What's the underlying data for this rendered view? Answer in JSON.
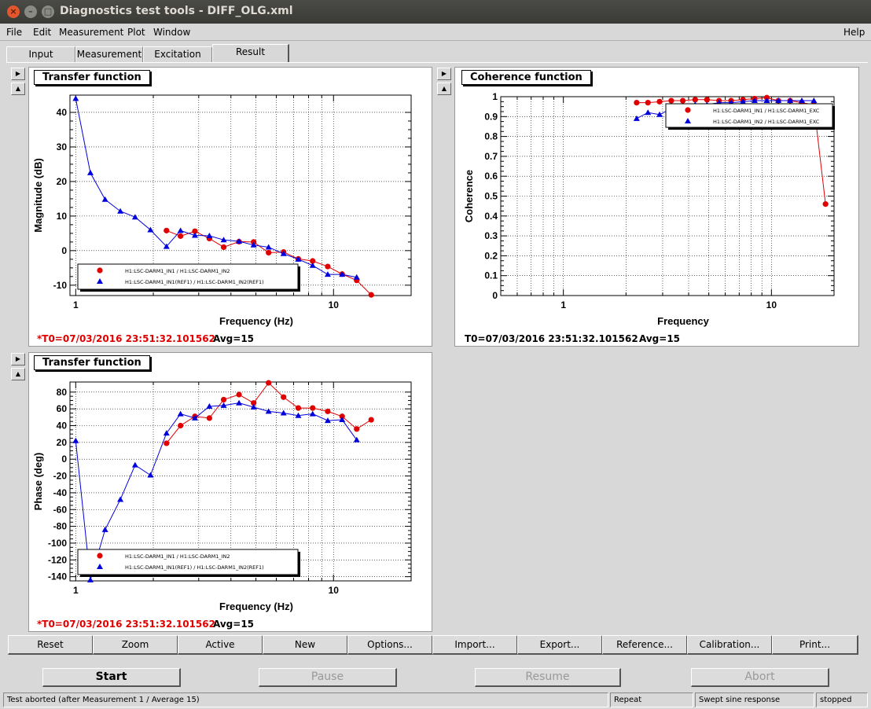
{
  "window": {
    "title": "Diagnostics test tools - DIFF_OLG.xml"
  },
  "menu": {
    "file": "File",
    "edit": "Edit",
    "measurement": "Measurement",
    "plot": "Plot",
    "window": "Window",
    "help": "Help"
  },
  "tabs": [
    {
      "label": "Input"
    },
    {
      "label": "Measurement"
    },
    {
      "label": "Excitation"
    },
    {
      "label": "Result",
      "active": true
    }
  ],
  "panels": {
    "tf_mag": {
      "title": "Transfer function",
      "t0": "*T0=07/03/2016 23:51:32.101562",
      "avg": "Avg=15"
    },
    "coh": {
      "title": "Coherence function",
      "t0": "T0=07/03/2016 23:51:32.101562",
      "avg": "Avg=15"
    },
    "tf_phase": {
      "title": "Transfer function",
      "t0": "*T0=07/03/2016 23:51:32.101562",
      "avg": "Avg=15"
    }
  },
  "plot_buttons": [
    "Reset",
    "Zoom",
    "Active",
    "New",
    "Options...",
    "Import...",
    "Export...",
    "Reference...",
    "Calibration...",
    "Print..."
  ],
  "control_buttons": {
    "start": "Start",
    "pause": "Pause",
    "resume": "Resume",
    "abort": "Abort"
  },
  "status": {
    "message": "Test aborted (after Measurement 1 / Average 15)",
    "mode": "Repeat",
    "type": "Swept sine response",
    "state": "stopped"
  },
  "colors": {
    "red_series": "#e00000",
    "blue_series": "#0000dd"
  },
  "chart_data": [
    {
      "type": "line",
      "id": "tf_mag",
      "xscale": "log",
      "xlabel": "Frequency (Hz)",
      "ylabel": "Magnitude (dB)",
      "xlim": [
        0.95,
        20
      ],
      "ylim": [
        -13,
        45
      ],
      "xticks": [
        1,
        10
      ],
      "yticks": [
        -10,
        0,
        10,
        20,
        30,
        40
      ],
      "legend": "bottom-left",
      "series": [
        {
          "name": "H1:LSC-DARM1_IN1 / H1:LSC-DARM1_IN2",
          "color": "#e00000",
          "marker": "circle",
          "x": [
            2.25,
            2.55,
            2.9,
            3.3,
            3.75,
            4.3,
            4.9,
            5.6,
            6.4,
            7.3,
            8.3,
            9.5,
            10.8,
            12.3,
            14,
            16,
            18.2
          ],
          "y": [
            5.8,
            4.2,
            5.6,
            3.5,
            1.0,
            2.6,
            2.5,
            -0.6,
            -0.4,
            -2.4,
            -3.0,
            -4.6,
            -6.8,
            -8.6,
            -12.8,
            null,
            null
          ]
        },
        {
          "name": "H1:LSC-DARM1_IN1(REF1) / H1:LSC-DARM1_IN2(REF1)",
          "color": "#0000dd",
          "marker": "triangle",
          "x": [
            1.0,
            1.14,
            1.3,
            1.49,
            1.7,
            1.95,
            2.25,
            2.55,
            2.9,
            3.3,
            3.75,
            4.3,
            4.9,
            5.6,
            6.4,
            7.3,
            8.3,
            9.5,
            10.8,
            12.3,
            14,
            16,
            18.2
          ],
          "y": [
            44,
            22.5,
            14.8,
            11.4,
            9.7,
            6.0,
            1.2,
            5.8,
            4.4,
            4.3,
            3.1,
            2.7,
            1.6,
            1.0,
            -0.9,
            -2.5,
            -4.3,
            -6.9,
            -6.9,
            -7.7,
            null,
            null,
            null
          ]
        }
      ]
    },
    {
      "type": "line",
      "id": "coh",
      "xscale": "log",
      "xlabel": "Frequency",
      "ylabel": "Coherence",
      "xlim": [
        0.5,
        20
      ],
      "ylim": [
        0,
        1
      ],
      "xticks": [
        1,
        10
      ],
      "yticks": [
        0,
        0.1,
        0.2,
        0.3,
        0.4,
        0.5,
        0.6,
        0.7,
        0.8,
        0.9,
        1
      ],
      "legend": "top-right",
      "series": [
        {
          "name": "H1:LSC-DARM1_IN1 / H1:LSC-DARM1_EXC",
          "color": "#e00000",
          "marker": "circle",
          "x": [
            2.25,
            2.55,
            2.9,
            3.3,
            3.75,
            4.3,
            4.9,
            5.6,
            6.4,
            7.3,
            8.3,
            9.5,
            10.8,
            12.3,
            14,
            16,
            18.2
          ],
          "y": [
            0.97,
            0.97,
            0.975,
            0.98,
            0.98,
            0.985,
            0.985,
            0.98,
            0.98,
            0.985,
            0.99,
            0.995,
            0.98,
            0.98,
            0.97,
            0.96,
            0.46
          ]
        },
        {
          "name": "H1:LSC-DARM1_IN2 / H1:LSC-DARM1_EXC",
          "color": "#0000dd",
          "marker": "triangle",
          "x": [
            2.25,
            2.55,
            2.9,
            3.3,
            3.75,
            4.3,
            4.9,
            5.6,
            6.4,
            7.3,
            8.3,
            9.5,
            10.8,
            12.3,
            14,
            16
          ],
          "y": [
            0.89,
            0.92,
            0.91,
            0.94,
            0.95,
            0.96,
            0.96,
            0.97,
            0.97,
            0.975,
            0.98,
            0.98,
            0.98,
            0.98,
            0.98,
            0.98
          ]
        }
      ]
    },
    {
      "type": "line",
      "id": "tf_phase",
      "xscale": "log",
      "xlabel": "Frequency (Hz)",
      "ylabel": "Phase (deg)",
      "xlim": [
        0.95,
        20
      ],
      "ylim": [
        -145,
        92
      ],
      "xticks": [
        1,
        10
      ],
      "yticks": [
        -140,
        -120,
        -100,
        -80,
        -60,
        -40,
        -20,
        0,
        20,
        40,
        60,
        80
      ],
      "legend": "bottom-left",
      "series": [
        {
          "name": "H1:LSC-DARM1_IN1 / H1:LSC-DARM1_IN2",
          "color": "#e00000",
          "marker": "circle",
          "x": [
            2.25,
            2.55,
            2.9,
            3.3,
            3.75,
            4.3,
            4.9,
            5.6,
            6.4,
            7.3,
            8.3,
            9.5,
            10.8,
            12.3,
            14,
            16,
            18.2
          ],
          "y": [
            19,
            40,
            51,
            49,
            71,
            77,
            67,
            91,
            74,
            61,
            61,
            57,
            51,
            36,
            47,
            null,
            null
          ]
        },
        {
          "name": "H1:LSC-DARM1_IN1(REF1) / H1:LSC-DARM1_IN2(REF1)",
          "color": "#0000dd",
          "marker": "triangle",
          "x": [
            1.0,
            1.14,
            1.3,
            1.49,
            1.7,
            1.95,
            2.25,
            2.55,
            2.9,
            3.3,
            3.75,
            4.3,
            4.9,
            5.6,
            6.4,
            7.3,
            8.3,
            9.5,
            10.8,
            12.3,
            14,
            16,
            18.2
          ],
          "y": [
            22,
            -144,
            -84,
            -48,
            -7,
            -19,
            31,
            54,
            49,
            63,
            64,
            67,
            62,
            57,
            55,
            52,
            54,
            46,
            47,
            23,
            null,
            null,
            null
          ]
        }
      ]
    }
  ]
}
